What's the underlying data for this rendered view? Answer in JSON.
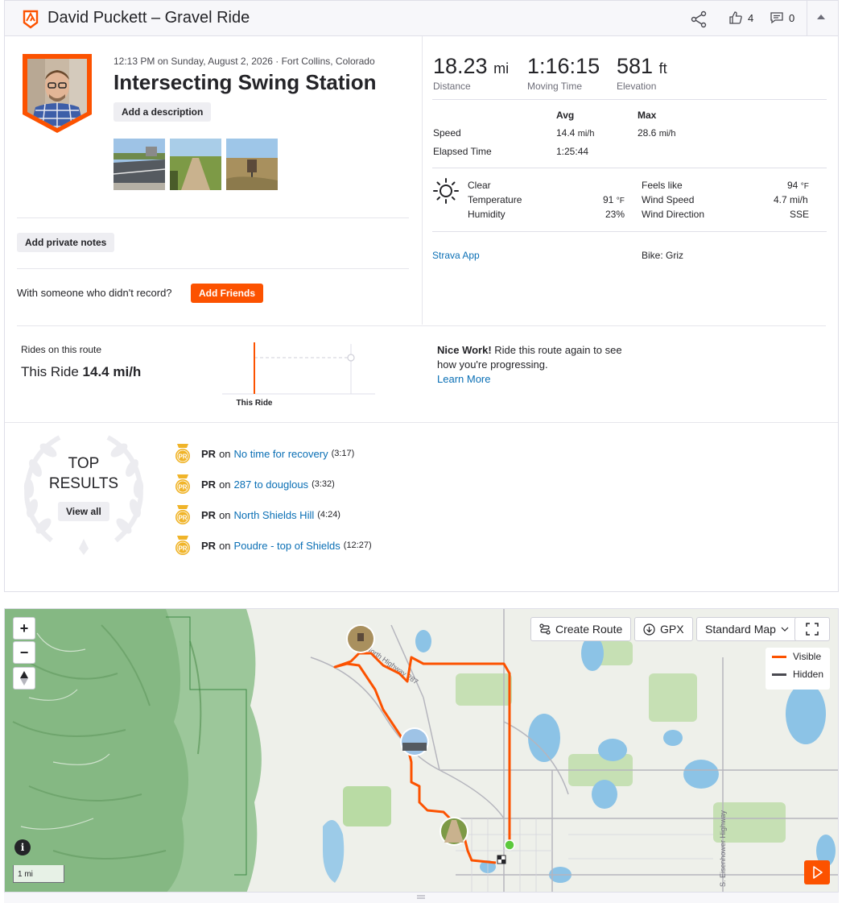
{
  "header": {
    "title": "David Puckett – Gravel Ride",
    "kudos_count": "4",
    "comments_count": "0"
  },
  "activity": {
    "meta": "12:13 PM on Sunday, August 2, 2026 · Fort Collins, Colorado",
    "name": "Intersecting Swing Station",
    "add_description": "Add a description",
    "add_private_notes": "Add private notes",
    "with_someone": "With someone who didn't record?",
    "add_friends": "Add Friends"
  },
  "stats": {
    "distance": {
      "value": "18.23",
      "unit": "mi",
      "label": "Distance"
    },
    "moving_time": {
      "value": "1:16:15",
      "label": "Moving Time"
    },
    "elevation": {
      "value": "581",
      "unit": "ft",
      "label": "Elevation"
    },
    "table": {
      "avg_header": "Avg",
      "max_header": "Max",
      "speed_label": "Speed",
      "speed_avg": "14.4",
      "speed_max": "28.6",
      "speed_unit": "mi/h",
      "elapsed_label": "Elapsed Time",
      "elapsed_value": "1:25:44"
    },
    "weather": {
      "condition": "Clear",
      "temperature_label": "Temperature",
      "temperature_value": "91",
      "temp_unit": "°F",
      "humidity_label": "Humidity",
      "humidity_value": "23%",
      "feels_like_label": "Feels like",
      "feels_like_value": "94",
      "wind_speed_label": "Wind Speed",
      "wind_speed_value": "4.7 mi/h",
      "wind_direction_label": "Wind Direction",
      "wind_direction_value": "SSE"
    },
    "device": "Strava App",
    "bike": "Bike: Griz"
  },
  "route_compare": {
    "label": "Rides on this route",
    "this_ride_prefix": "This Ride",
    "this_ride_speed": "14.4 mi/h",
    "chart_label": "This Ride",
    "nice_work_bold": "Nice Work!",
    "nice_work_text": " Ride this route again to see how you're progressing.",
    "learn_more": "Learn More"
  },
  "top_results": {
    "title_line1": "TOP",
    "title_line2": "RESULTS",
    "view_all": "View all",
    "medal_text": "PR",
    "items": [
      {
        "pr": "PR",
        "on": "on",
        "segment": "No time for recovery",
        "time": "(3:17)"
      },
      {
        "pr": "PR",
        "on": "on",
        "segment": "287 to douglous",
        "time": "(3:32)"
      },
      {
        "pr": "PR",
        "on": "on",
        "segment": "North Shields Hill",
        "time": "(4:24)"
      },
      {
        "pr": "PR",
        "on": "on",
        "segment": "Poudre - top of Shields",
        "time": "(12:27)"
      }
    ]
  },
  "map": {
    "create_route": "Create Route",
    "gpx": "GPX",
    "map_type": "Standard Map",
    "legend_visible": "Visible",
    "legend_hidden": "Hidden",
    "scale": "1 mi",
    "road_label_1": "North Highway 287",
    "road_label_2": "S. Eisenhower Highway",
    "zoom_in": "+",
    "zoom_out": "−",
    "info": "i",
    "route_color": "#fc5200"
  },
  "colors": {
    "brand": "#fc5200",
    "link": "#0a6fb5",
    "medal": "#f0b429"
  }
}
